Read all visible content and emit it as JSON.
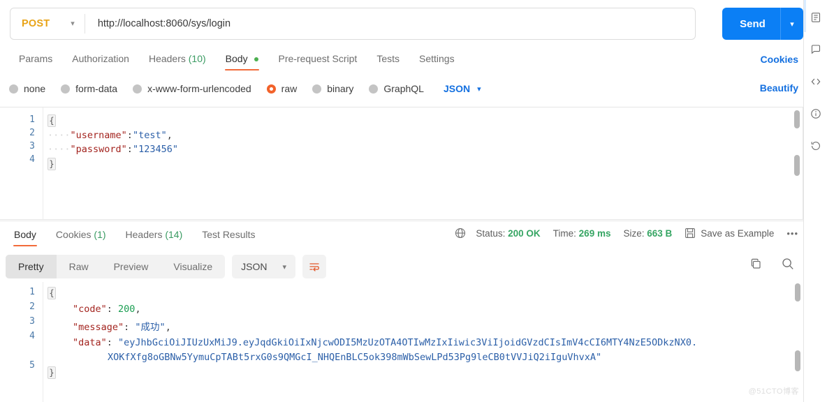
{
  "request": {
    "method": "POST",
    "url": "http://localhost:8060/sys/login",
    "send_label": "Send",
    "tabs": [
      {
        "label": "Params",
        "count": "",
        "active": false,
        "dot": false
      },
      {
        "label": "Authorization",
        "count": "",
        "active": false,
        "dot": false
      },
      {
        "label": "Headers",
        "count": "(10)",
        "active": false,
        "dot": false
      },
      {
        "label": "Body",
        "count": "",
        "active": true,
        "dot": true
      },
      {
        "label": "Pre-request Script",
        "count": "",
        "active": false,
        "dot": false
      },
      {
        "label": "Tests",
        "count": "",
        "active": false,
        "dot": false
      },
      {
        "label": "Settings",
        "count": "",
        "active": false,
        "dot": false
      }
    ],
    "cookies_link": "Cookies",
    "beautify_link": "Beautify",
    "body_types": [
      {
        "label": "none",
        "selected": false
      },
      {
        "label": "form-data",
        "selected": false
      },
      {
        "label": "x-www-form-urlencoded",
        "selected": false
      },
      {
        "label": "raw",
        "selected": true
      },
      {
        "label": "binary",
        "selected": false
      },
      {
        "label": "GraphQL",
        "selected": false
      }
    ],
    "raw_format": "JSON",
    "body_lines": [
      "1",
      "2",
      "3",
      "4"
    ],
    "body_code": {
      "line1_brace": "{",
      "line2_indent": "····",
      "line2_key": "\"username\"",
      "line2_colon": ":",
      "line2_value": "\"test\"",
      "line2_comma": ",",
      "line3_indent": "····",
      "line3_key": "\"password\"",
      "line3_colon": ":",
      "line3_value": "\"123456\"",
      "line4_brace": "}"
    }
  },
  "response": {
    "tabs": [
      {
        "label": "Body",
        "count": "",
        "active": true
      },
      {
        "label": "Cookies",
        "count": "(1)",
        "active": false
      },
      {
        "label": "Headers",
        "count": "(14)",
        "active": false
      },
      {
        "label": "Test Results",
        "count": "",
        "active": false
      }
    ],
    "status_label": "Status:",
    "status_value": "200 OK",
    "time_label": "Time:",
    "time_value": "269 ms",
    "size_label": "Size:",
    "size_value": "663 B",
    "save_example": "Save as Example",
    "more_dots": "•••",
    "view_modes": [
      {
        "label": "Pretty",
        "active": true
      },
      {
        "label": "Raw",
        "active": false
      },
      {
        "label": "Preview",
        "active": false
      },
      {
        "label": "Visualize",
        "active": false
      }
    ],
    "format": "JSON",
    "body_lines": [
      "1",
      "2",
      "3",
      "4",
      "5"
    ],
    "body_code": {
      "line1_brace": "{",
      "line2_key": "\"code\"",
      "line2_colon": ": ",
      "line2_value": "200",
      "line2_comma": ",",
      "line3_key": "\"message\"",
      "line3_colon": ": ",
      "line3_value": "\"成功\"",
      "line3_comma": ",",
      "line4_key": "\"data\"",
      "line4_colon": ": ",
      "line4_value_part1": "\"eyJhbGciOiJIUzUxMiJ9.eyJqdGkiOiIxNjcwODI5MzUzOTA4OTIwMzIxIiwic3ViIjoidGVzdCIsImV4cCI6MTY4NzE5ODkzNX0.",
      "line4_value_part2": "XOKfXfg8oGBNw5YymuCpTABt5rxG0s9QMGcI_NHQEnBLC5ok398mWbSewLPd53Pg9leCB0tVVJiQ2iIguVhvxA\"",
      "line5_brace": "}"
    }
  },
  "watermark": "@51CTO博客"
}
